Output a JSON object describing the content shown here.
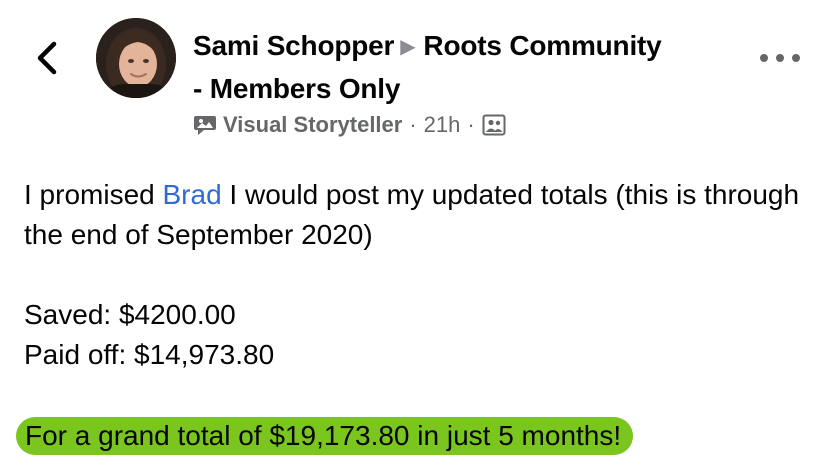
{
  "header": {
    "author": "Sami Schopper",
    "group_line1": "Roots Community",
    "group_line2": "- Members Only",
    "badge": "Visual Storyteller",
    "time": "21h"
  },
  "post": {
    "intro_before_mention": "I promised ",
    "mention": "Brad",
    "intro_after_mention": " I would post my updated totals (this is through the end of September 2020)",
    "saved": "Saved: $4200.00",
    "paid_off": "Paid off: $14,973.80",
    "grand_total": "For a grand total of $19,173.80 in just 5 months!"
  },
  "colors": {
    "highlight": "#7ac51e",
    "mention": "#2e6bd6",
    "meta_text": "#65676b"
  },
  "icons": {
    "back": "chevron-left-icon",
    "arrow": "play-triangle-icon",
    "badge": "visual-storyteller-icon",
    "audience": "group-audience-icon",
    "more": "more-options-icon"
  }
}
